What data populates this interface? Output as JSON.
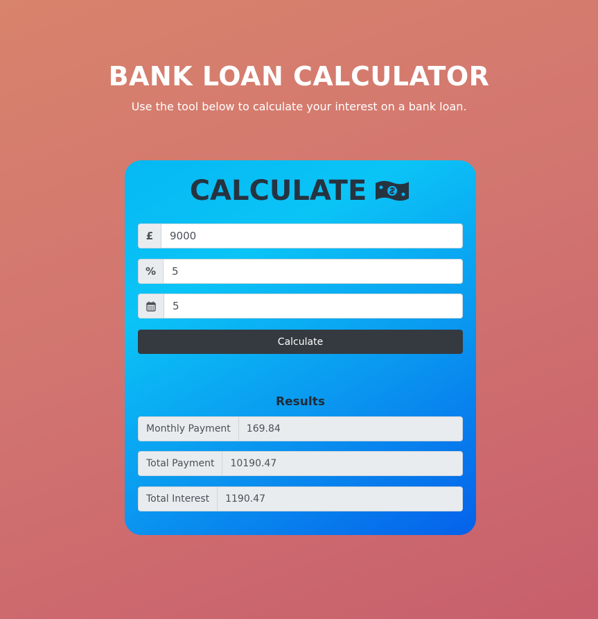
{
  "header": {
    "title": "BANK LOAN CALCULATOR",
    "subtitle": "Use the tool below to calculate your interest on a bank loan."
  },
  "card": {
    "title": "CALCULATE",
    "title_icon": "money-bill-icon"
  },
  "fields": {
    "amount": {
      "addon": "£",
      "value": "9000",
      "icon": "pound-sign-icon"
    },
    "interest": {
      "addon": "%",
      "value": "5",
      "icon": "percent-icon"
    },
    "years": {
      "addon": "",
      "value": "5",
      "icon": "calendar-icon"
    }
  },
  "button": {
    "label": "Calculate"
  },
  "results": {
    "title": "Results",
    "monthly_payment": {
      "label": "Monthly Payment",
      "value": "169.84"
    },
    "total_payment": {
      "label": "Total Payment",
      "value": "10190.47"
    },
    "total_interest": {
      "label": "Total Interest",
      "value": "1190.47"
    }
  },
  "colors": {
    "background_start": "#d8836c",
    "background_end": "#c75f6c",
    "card_start": "#05b8f3",
    "card_end": "#0561ea",
    "button": "#343a40",
    "title_text": "#263340"
  }
}
